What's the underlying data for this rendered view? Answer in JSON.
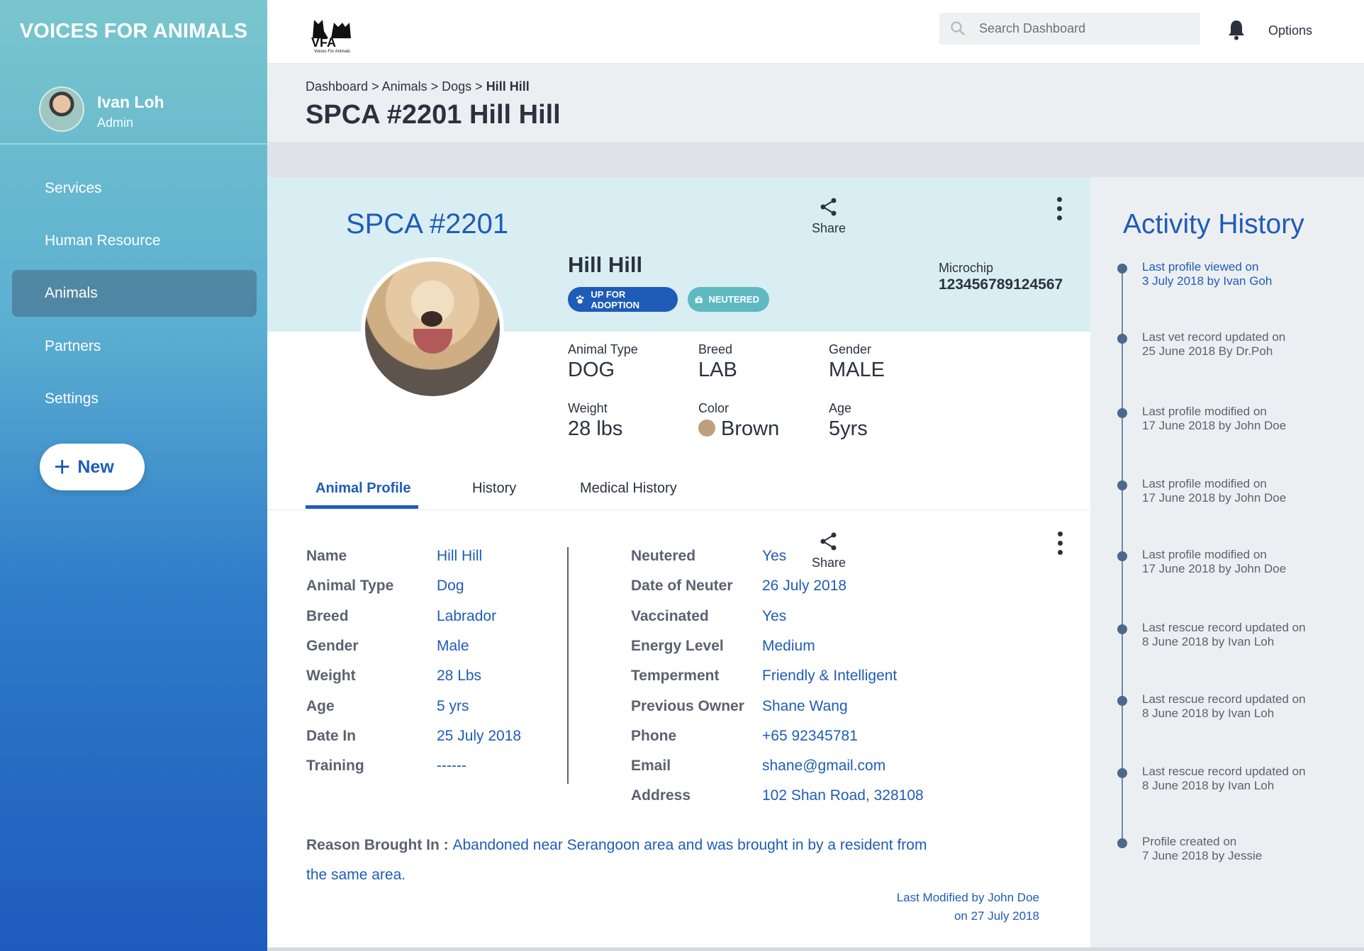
{
  "sidebar": {
    "brand": "VOICES FOR ANIMALS",
    "user_name": "Ivan Loh",
    "user_role": "Admin",
    "nav": [
      "Services",
      "Human Resource",
      "Animals",
      "Partners",
      "Settings"
    ],
    "new_label": "New"
  },
  "topbar": {
    "logo_text": "VFA",
    "logo_caption": "Voices For Animals",
    "search_placeholder": "Search Dashboard",
    "options_label": "Options"
  },
  "header": {
    "breadcrumb": [
      "Dashboard",
      "Animals",
      "Dogs",
      "Hill Hill"
    ],
    "breadcrumb_sep": " > ",
    "title": "SPCA #2201 Hill Hill"
  },
  "profile": {
    "id": "SPCA #2201",
    "name": "Hill Hill",
    "badges": [
      "UP FOR ADOPTION",
      "NEUTERED"
    ],
    "share_label": "Share",
    "microchip_label": "Microchip",
    "microchip_value": "123456789124567",
    "stats": [
      {
        "label": "Animal Type",
        "value": "DOG"
      },
      {
        "label": "Breed",
        "value": "LAB"
      },
      {
        "label": "Gender",
        "value": "MALE"
      },
      {
        "label": "Weight",
        "value": "28 lbs"
      },
      {
        "label": "Color",
        "value": "Brown"
      },
      {
        "label": "Age",
        "value": "5yrs"
      }
    ],
    "color_swatch": "#bf9e80"
  },
  "tabs": [
    "Animal Profile",
    "History",
    "Medical History"
  ],
  "details": {
    "left": [
      {
        "label": "Name",
        "value": "Hill Hill"
      },
      {
        "label": "Animal Type",
        "value": "Dog"
      },
      {
        "label": "Breed",
        "value": "Labrador"
      },
      {
        "label": "Gender",
        "value": "Male"
      },
      {
        "label": "Weight",
        "value": "28 Lbs"
      },
      {
        "label": "Age",
        "value": "5 yrs"
      },
      {
        "label": "Date In",
        "value": "25 July 2018"
      },
      {
        "label": "Training",
        "value": "------"
      }
    ],
    "right": [
      {
        "label": "Neutered",
        "value": "Yes"
      },
      {
        "label": "Date of Neuter",
        "value": "26 July 2018"
      },
      {
        "label": "Vaccinated",
        "value": "Yes"
      },
      {
        "label": "Energy Level",
        "value": "Medium"
      },
      {
        "label": "Temperment",
        "value": "Friendly & Intelligent"
      },
      {
        "label": "Previous Owner",
        "value": "Shane Wang"
      },
      {
        "label": "Phone",
        "value": "+65 92345781"
      },
      {
        "label": "Email",
        "value": "shane@gmail.com"
      },
      {
        "label": "Address",
        "value": "102 Shan Road, 328108"
      }
    ],
    "share_label": "Share",
    "reason_label": "Reason Brought In : ",
    "reason_text": "Abandoned near Serangoon area and was brought in by a resident from the same area.",
    "last_modified": "Last Modified by John Doe on 27 July 2018"
  },
  "activity": {
    "title": "Activity History",
    "items": [
      {
        "line1": "Last profile viewed on",
        "line2": "3 July 2018 by Ivan Goh",
        "highlight": true
      },
      {
        "line1": "Last vet record updated on",
        "line2": "25 June 2018 By Dr.Poh",
        "highlight": false
      },
      {
        "line1": "Last profile modified on",
        "line2": "17 June 2018 by John Doe",
        "highlight": false
      },
      {
        "line1": "Last profile modified on",
        "line2": "17 June 2018 by John Doe",
        "highlight": false
      },
      {
        "line1": "Last profile modified on",
        "line2": "17 June 2018 by John Doe",
        "highlight": false
      },
      {
        "line1": "Last rescue record updated on",
        "line2": "8 June 2018 by Ivan Loh",
        "highlight": false
      },
      {
        "line1": "Last rescue record updated on",
        "line2": "8 June 2018 by Ivan Loh",
        "highlight": false
      },
      {
        "line1": "Last rescue record updated on",
        "line2": "8 June 2018 by Ivan Loh",
        "highlight": false
      },
      {
        "line1": "Profile created on",
        "line2": "7 June 2018 by Jessie",
        "highlight": false
      }
    ]
  },
  "colors": {
    "accent_blue": "#1f5cb8",
    "teal": "#5fb9c0",
    "label_gray": "#5b6170"
  }
}
